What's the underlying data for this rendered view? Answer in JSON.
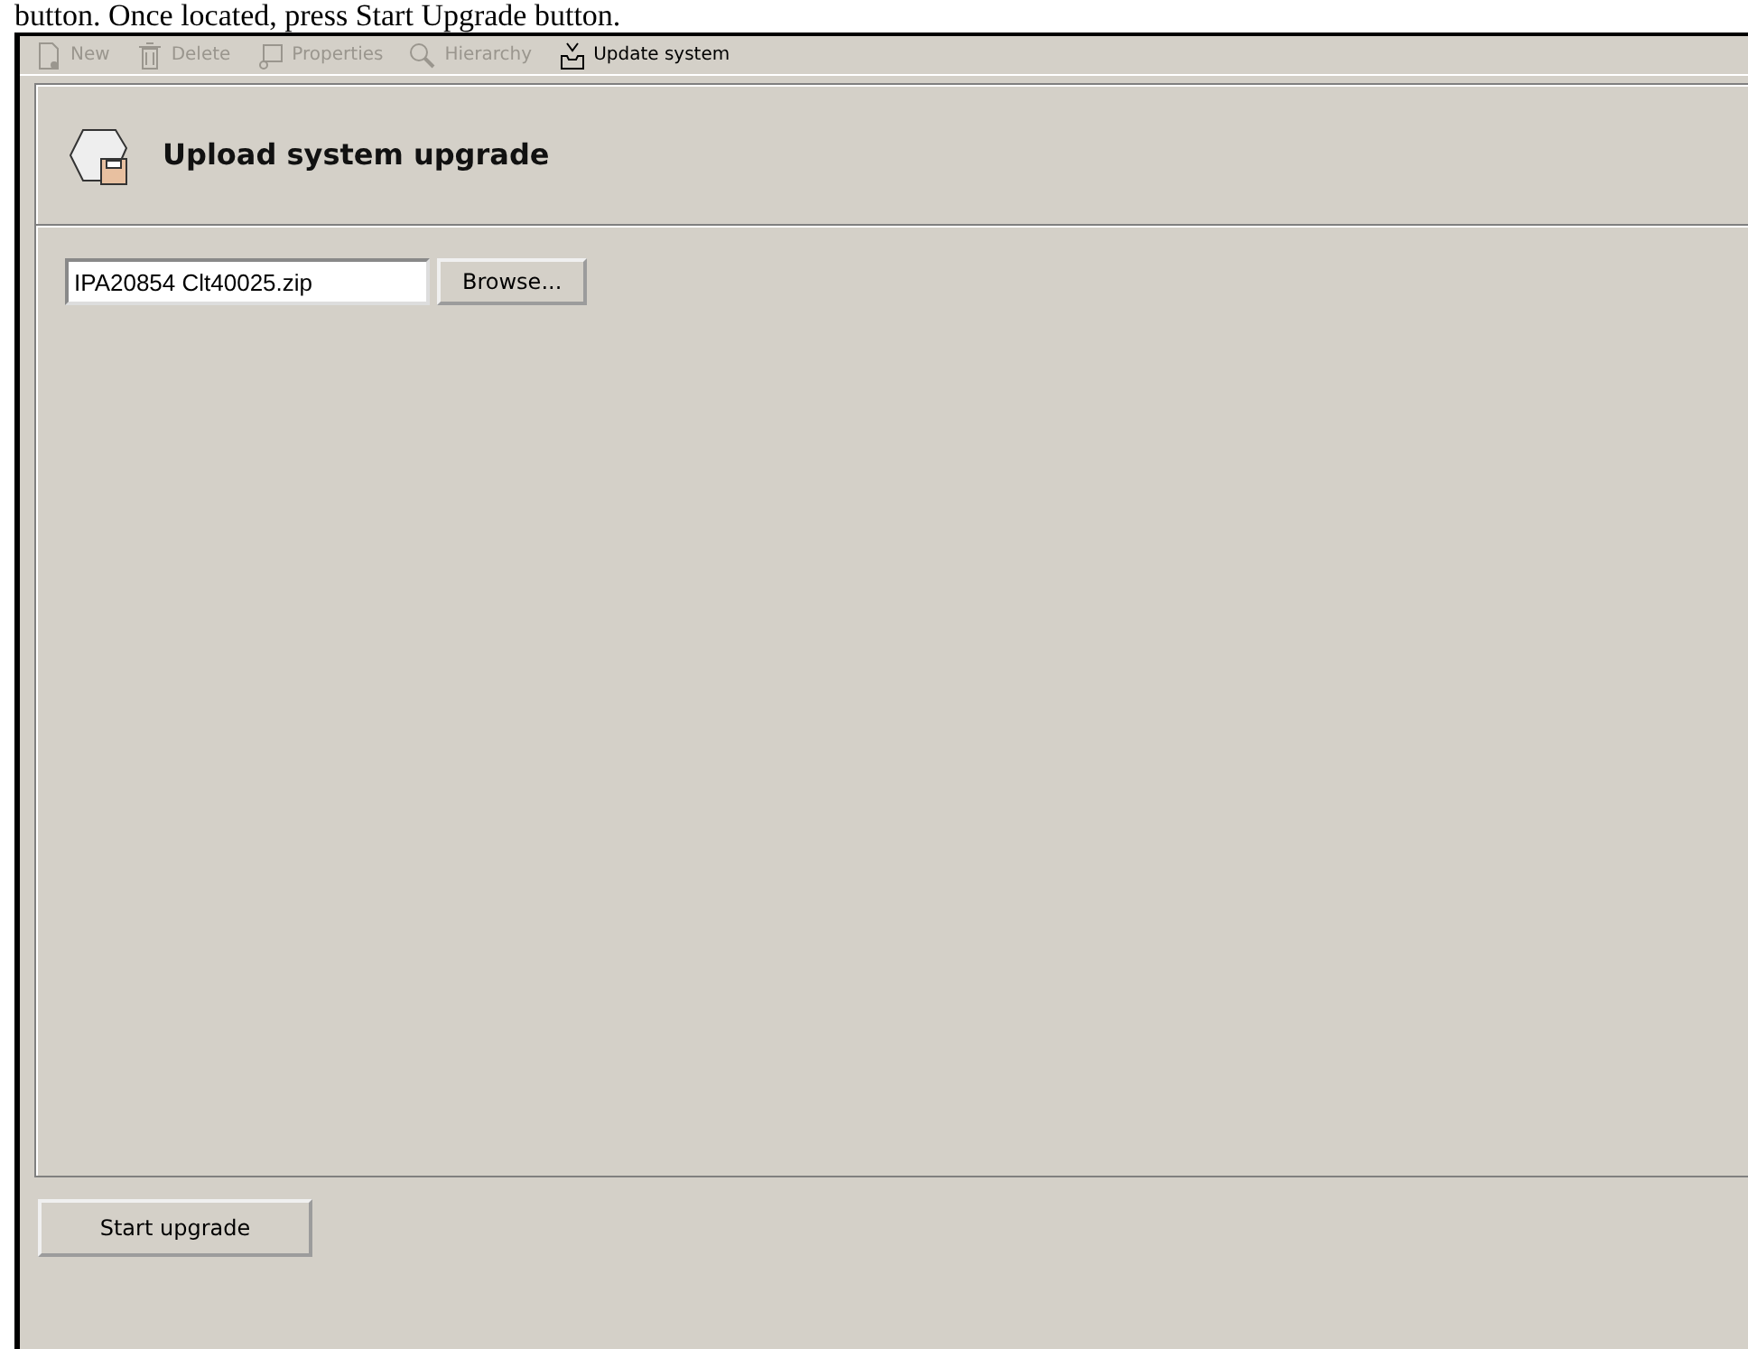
{
  "caption": "button. Once located, press Start Upgrade button.",
  "toolbar": [
    {
      "label": "New",
      "disabled": true
    },
    {
      "label": "Delete",
      "disabled": true
    },
    {
      "label": "Properties",
      "disabled": true
    },
    {
      "label": "Hierarchy",
      "disabled": true
    },
    {
      "label": "Update system",
      "disabled": false
    }
  ],
  "panel": {
    "title": "Upload system upgrade",
    "file_value": "IPA20854 Clt40025.zip",
    "browse_button": "Browse..."
  },
  "footer_button": "Start upgrade"
}
